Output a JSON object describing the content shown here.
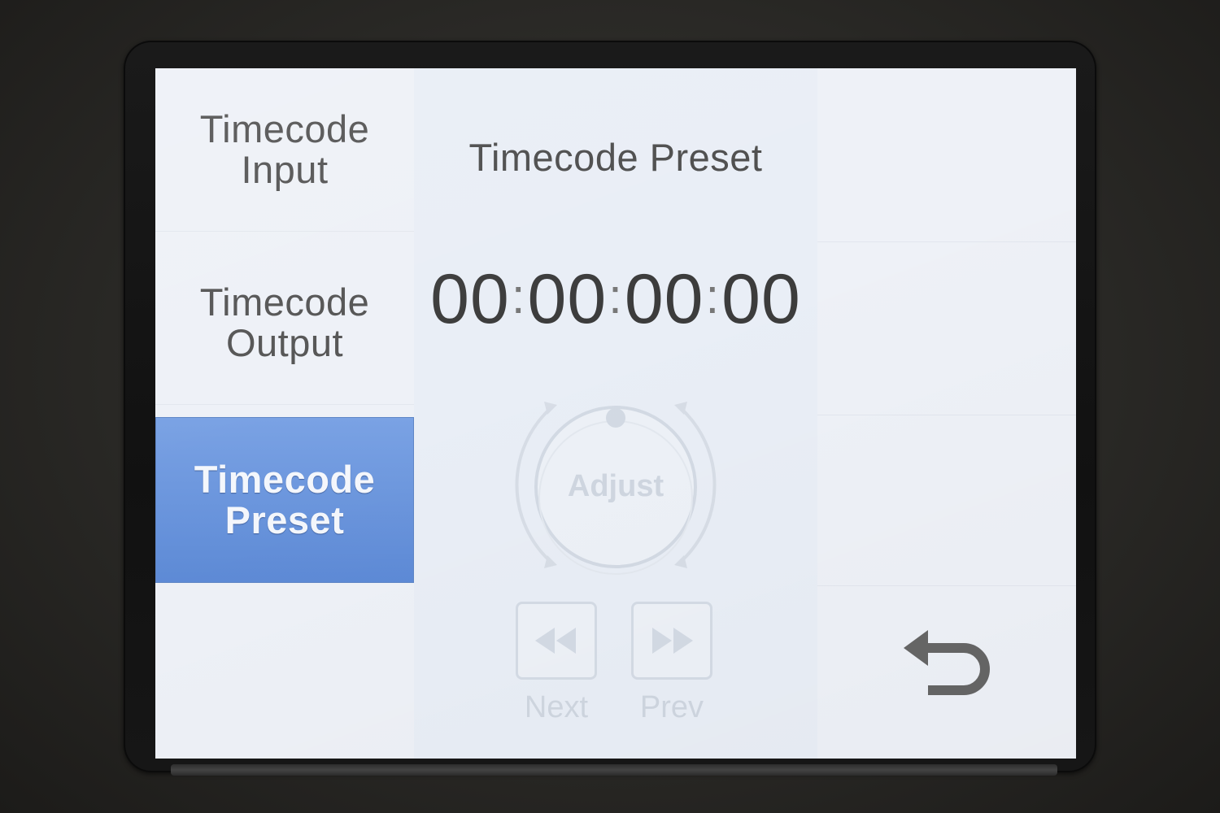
{
  "menu": {
    "items": [
      {
        "line1": "Timecode",
        "line2": "Input",
        "active": false
      },
      {
        "line1": "Timecode",
        "line2": "Output",
        "active": false
      },
      {
        "line1": "Timecode",
        "line2": "Preset",
        "active": true
      }
    ]
  },
  "main": {
    "title": "Timecode Preset",
    "timecode": {
      "hours": "00",
      "minutes": "00",
      "seconds": "00",
      "frames": "00",
      "separator": ":"
    },
    "dial": {
      "label": "Adjust",
      "icon": "rotary-dial-icon"
    },
    "buttons": {
      "left_label": "Next",
      "left_icon": "rewind-icon",
      "right_label": "Prev",
      "right_icon": "fast-forward-icon"
    }
  },
  "right_panel": {
    "back_icon": "back-arrow-icon"
  },
  "colors": {
    "accent": "#6a95dc",
    "screen_bg": "#eef2f8",
    "text": "#4d4d4d",
    "disabled": "#cfd6e0"
  }
}
